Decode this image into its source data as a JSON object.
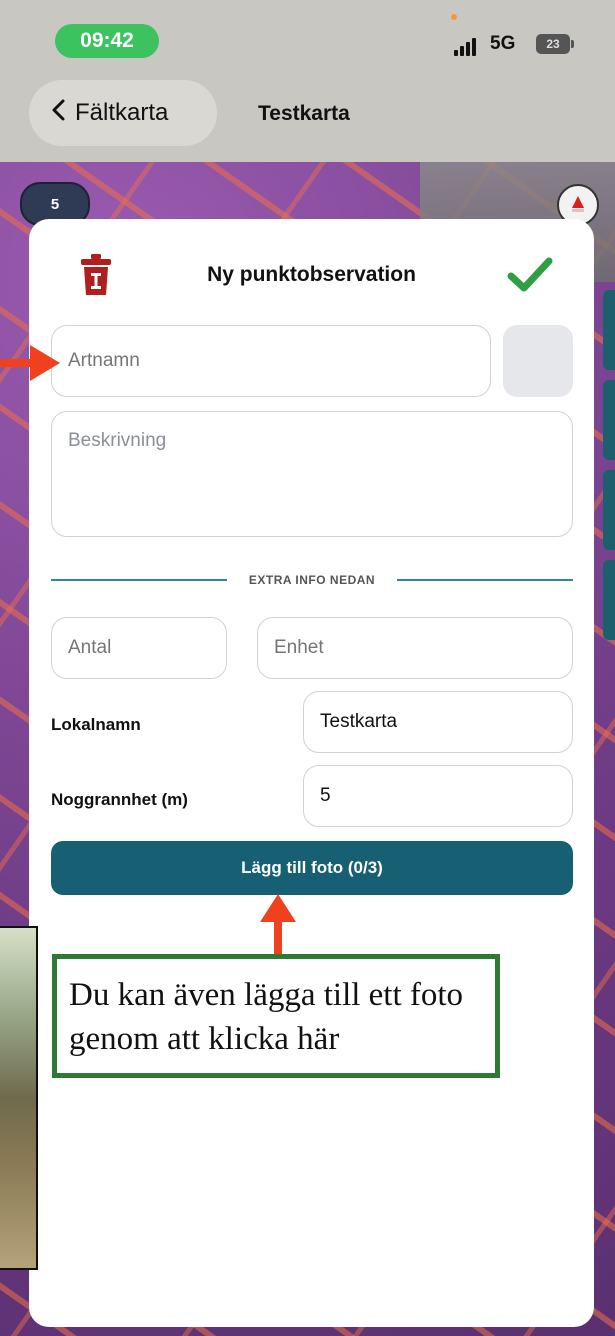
{
  "status_bar": {
    "time": "09:42",
    "network": "5G",
    "battery": "23"
  },
  "nav": {
    "back_label": "Fältkarta",
    "title": "Testkarta"
  },
  "map": {
    "cluster_count": "5"
  },
  "modal": {
    "title": "Ny punktobservation",
    "species": {
      "placeholder": "Artnamn"
    },
    "description": {
      "placeholder": "Beskrivning"
    },
    "divider_label": "EXTRA INFO NEDAN",
    "count": {
      "placeholder": "Antal"
    },
    "unit": {
      "placeholder": "Enhet"
    },
    "locale": {
      "label": "Lokalnamn",
      "value": "Testkarta"
    },
    "accuracy": {
      "label": "Noggrannhet (m)",
      "value": "5"
    },
    "add_photo_label": "Lägg till foto (0/3)"
  },
  "annotation": {
    "callout_text": "Du kan även lägga till ett foto genom att klicka här"
  },
  "colors": {
    "primary": "#175f73",
    "confirm": "#2ea043",
    "delete": "#b01e1e",
    "arrow": "#f0401e",
    "callout_border": "#2e7a34",
    "time_pill": "#3cc25e"
  },
  "icons": [
    "trash-icon",
    "check-icon",
    "chevron-left-icon",
    "compass-icon",
    "signal-icon",
    "battery-icon"
  ]
}
